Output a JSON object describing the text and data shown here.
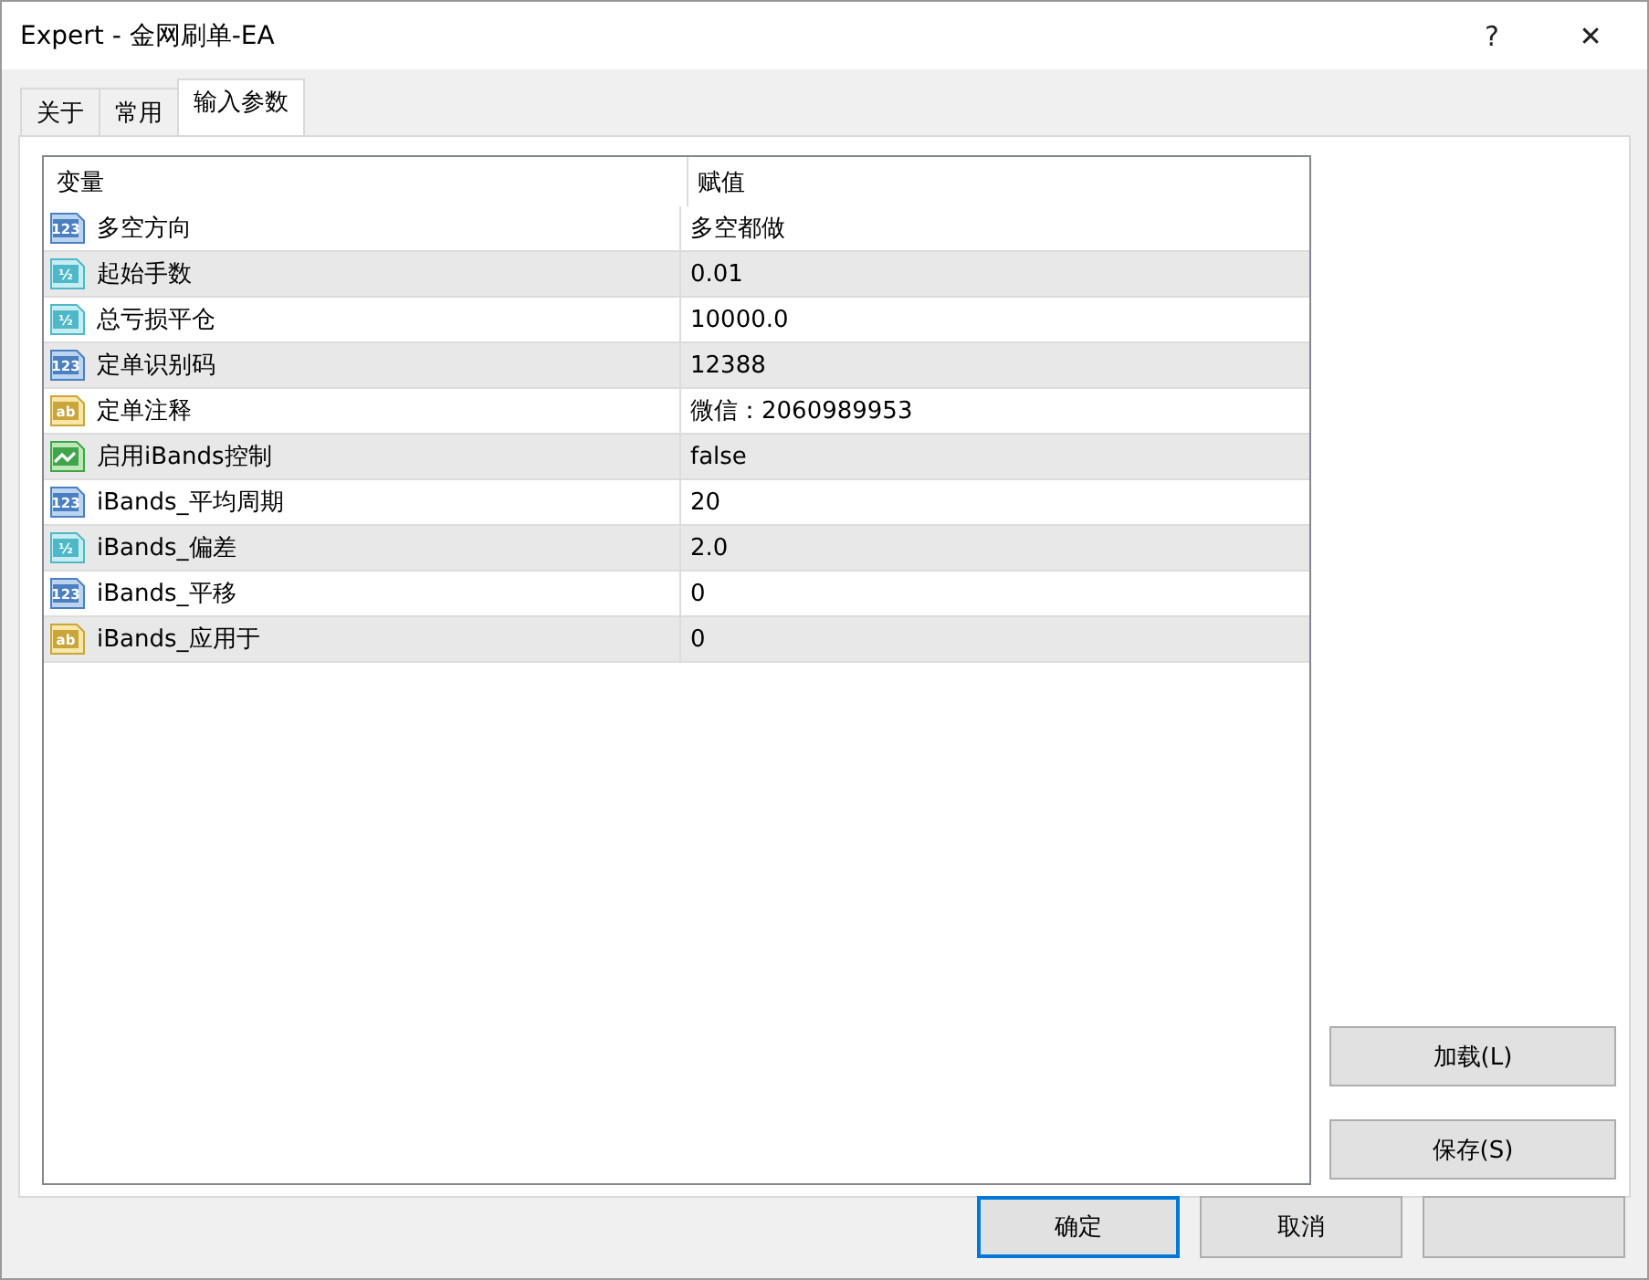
{
  "window": {
    "title": "Expert - 金网刷单-EA",
    "help": "?",
    "close": "✕"
  },
  "tabs": [
    {
      "label": "关于",
      "selected": false
    },
    {
      "label": "常用",
      "selected": false
    },
    {
      "label": "输入参数",
      "selected": true
    }
  ],
  "table": {
    "columns": [
      "变量",
      "赋值"
    ],
    "rows": [
      {
        "kind": "int",
        "icon": "123",
        "name": "多空方向",
        "value": "多空都做"
      },
      {
        "kind": "double",
        "icon": "½",
        "name": "起始手数",
        "value": "0.01"
      },
      {
        "kind": "double",
        "icon": "½",
        "name": "总亏损平仓",
        "value": "10000.0"
      },
      {
        "kind": "int",
        "icon": "123",
        "name": "定单识别码",
        "value": "12388"
      },
      {
        "kind": "string",
        "icon": "ab",
        "name": "定单注释",
        "value": "微信：2060989953"
      },
      {
        "kind": "bool",
        "name": "启用iBands控制",
        "value": "false"
      },
      {
        "kind": "int",
        "icon": "123",
        "name": "iBands_平均周期",
        "value": "20"
      },
      {
        "kind": "double",
        "icon": "½",
        "name": "iBands_偏差",
        "value": "2.0"
      },
      {
        "kind": "int",
        "icon": "123",
        "name": "iBands_平移",
        "value": "0"
      },
      {
        "kind": "string",
        "icon": "ab",
        "name": "iBands_应用于",
        "value": "0"
      }
    ]
  },
  "side_buttons": [
    "加载(L)",
    "保存(S)"
  ],
  "buttons": [
    {
      "label": "确定",
      "selected": true
    },
    {
      "label": "取消",
      "selected": false
    },
    {
      "selected": false
    }
  ]
}
